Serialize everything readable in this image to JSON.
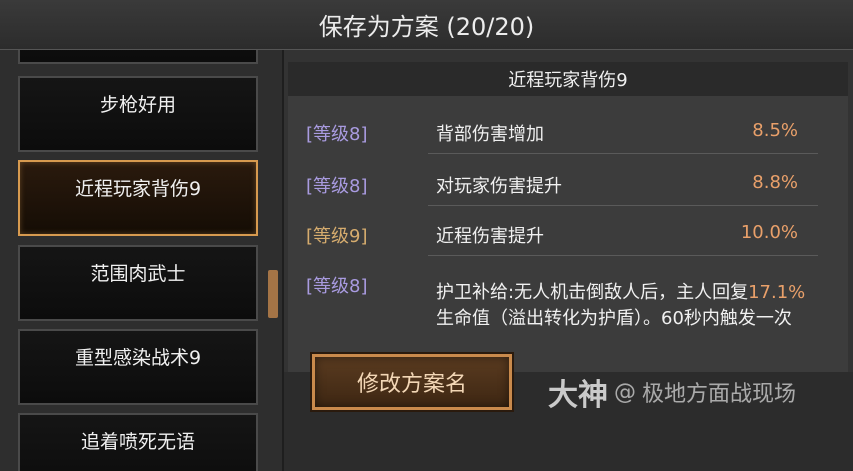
{
  "header": {
    "title": "保存为方案 (20/20)"
  },
  "plans": [
    {
      "label": ""
    },
    {
      "label": "步枪好用"
    },
    {
      "label": "近程玩家背伤9"
    },
    {
      "label": "范围肉武士"
    },
    {
      "label": "重型感染战术9"
    },
    {
      "label": "追着喷死无语"
    }
  ],
  "detail": {
    "title": "近程玩家背伤9",
    "attributes": [
      {
        "level": "[等级8]",
        "name": "背部伤害增加",
        "value": "8.5%"
      },
      {
        "level": "[等级8]",
        "name": "对玩家伤害提升",
        "value": "8.8%"
      },
      {
        "level": "[等级9]",
        "name": "近程伤害提升",
        "value": "10.0%"
      },
      {
        "level": "[等级8]",
        "desc_before": "护卫补给:无人机击倒敌人后，主人回复",
        "desc_highlight": "17.1%",
        "desc_after": "生命值（溢出转化为护盾）。60秒内触发一次"
      }
    ]
  },
  "buttons": {
    "rename": "修改方案名"
  },
  "watermark": {
    "logo": "大神",
    "text": "极地方面战现场"
  },
  "colors": {
    "accent": "#d79a4f",
    "value": "#e9a06a",
    "level_purple": "#a99be0",
    "level_gold": "#d6ac6e"
  }
}
